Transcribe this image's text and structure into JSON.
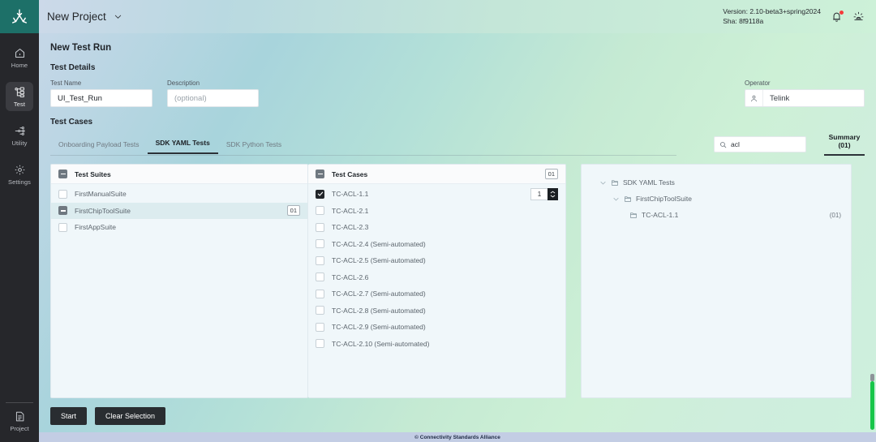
{
  "app": {
    "logo_icon": "csa-matter-logo-icon",
    "project_name": "New Project",
    "project_caret_icon": "chevron-down-icon",
    "version_line1": "Version: 2.10-beta3+spring2024",
    "version_line2": "Sha: 8f9118a",
    "bell_icon": "notification-bell-icon",
    "theme_icon": "brightness-theme-icon",
    "accent_green": "#1d7068",
    "rail_bg": "#26272b",
    "scrollbar_color": "#18c64a"
  },
  "sidebar": {
    "items": [
      {
        "label": "Home",
        "icon": "home-icon",
        "active": false
      },
      {
        "label": "Test",
        "icon": "test-tree-icon",
        "active": true
      },
      {
        "label": "Utility",
        "icon": "utility-node-icon",
        "active": false
      },
      {
        "label": "Settings",
        "icon": "gear-icon",
        "active": false
      }
    ],
    "bottom": {
      "label": "Project",
      "icon": "project-document-icon"
    }
  },
  "page": {
    "title": "New Test Run",
    "details_heading": "Test Details",
    "test_name": {
      "label": "Test Name",
      "value": "UI_Test_Run"
    },
    "description": {
      "label": "Description",
      "placeholder": "(optional)",
      "value": ""
    },
    "operator": {
      "label": "Operator",
      "value": "Telink",
      "icon": "person-icon"
    },
    "test_cases_heading": "Test Cases"
  },
  "tabs": [
    {
      "label": "Onboarding Payload Tests",
      "active": false
    },
    {
      "label": "SDK YAML Tests",
      "active": true
    },
    {
      "label": "SDK Python Tests",
      "active": false
    }
  ],
  "search": {
    "value": "acl",
    "placeholder": "Search",
    "icon": "search-icon"
  },
  "summary_tab": {
    "label": "Summary (01)",
    "active": true
  },
  "suites_panel": {
    "title": "Test Suites",
    "header_checkbox": "indeterminate",
    "rows": [
      {
        "label": "FirstManualSuite",
        "state": "unchecked",
        "selected": false,
        "badge": ""
      },
      {
        "label": "FirstChipToolSuite",
        "state": "indeterminate",
        "selected": true,
        "badge": "01"
      },
      {
        "label": "FirstAppSuite",
        "state": "unchecked",
        "selected": false,
        "badge": ""
      }
    ]
  },
  "cases_panel": {
    "title": "Test Cases",
    "header_checkbox": "indeterminate",
    "header_badge": "01",
    "rows": [
      {
        "label": "TC-ACL-1.1",
        "state": "checked",
        "count": "1"
      },
      {
        "label": "TC-ACL-2.1",
        "state": "unchecked",
        "count": ""
      },
      {
        "label": "TC-ACL-2.3",
        "state": "unchecked",
        "count": ""
      },
      {
        "label": "TC-ACL-2.4 (Semi-automated)",
        "state": "unchecked",
        "count": ""
      },
      {
        "label": "TC-ACL-2.5 (Semi-automated)",
        "state": "unchecked",
        "count": ""
      },
      {
        "label": "TC-ACL-2.6",
        "state": "unchecked",
        "count": ""
      },
      {
        "label": "TC-ACL-2.7 (Semi-automated)",
        "state": "unchecked",
        "count": ""
      },
      {
        "label": "TC-ACL-2.8 (Semi-automated)",
        "state": "unchecked",
        "count": ""
      },
      {
        "label": "TC-ACL-2.9 (Semi-automated)",
        "state": "unchecked",
        "count": ""
      },
      {
        "label": "TC-ACL-2.10 (Semi-automated)",
        "state": "unchecked",
        "count": ""
      }
    ]
  },
  "summary_panel": {
    "nodes": [
      {
        "label": "SDK YAML Tests",
        "depth": 0,
        "expanded": true,
        "count": ""
      },
      {
        "label": "FirstChipToolSuite",
        "depth": 1,
        "expanded": true,
        "count": ""
      },
      {
        "label": "TC-ACL-1.1",
        "depth": 2,
        "expanded": false,
        "count": "(01)"
      }
    ]
  },
  "actions": {
    "start_label": "Start",
    "clear_label": "Clear Selection"
  },
  "footer": {
    "text": "© Connectivity Standards Alliance"
  }
}
